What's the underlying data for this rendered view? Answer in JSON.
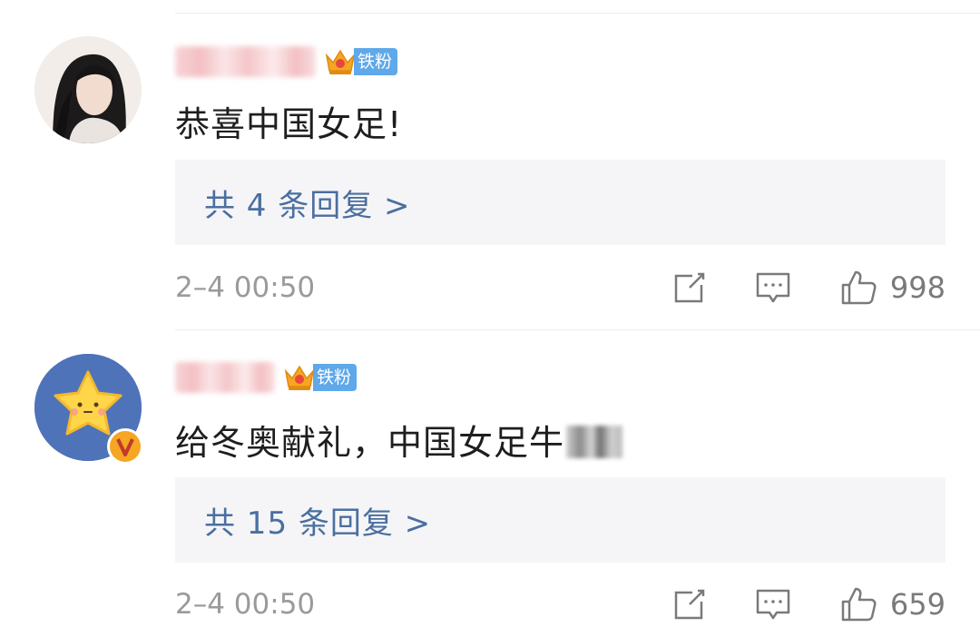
{
  "comments": [
    {
      "badge": "铁粉",
      "text": "恭喜中国女足!",
      "replies": "共 4 条回复 >",
      "time": "2–4 00:50",
      "likes": "998"
    },
    {
      "badge": "铁粉",
      "text": "给冬奥献礼，中国女足牛",
      "replies": "共 15 条回复 >",
      "time": "2–4 00:50",
      "likes": "659"
    }
  ],
  "icons": {
    "badge": "crown-icon",
    "share": "share-icon",
    "reply": "comment-icon",
    "like": "thumbs-up-icon",
    "verified": "verified-v-icon"
  },
  "colors": {
    "reply_link": "#4a6fa0",
    "badge_bg": "#5fa8e9",
    "reply_box_bg": "#f5f5f7",
    "meta_text": "#9a9a9a"
  }
}
